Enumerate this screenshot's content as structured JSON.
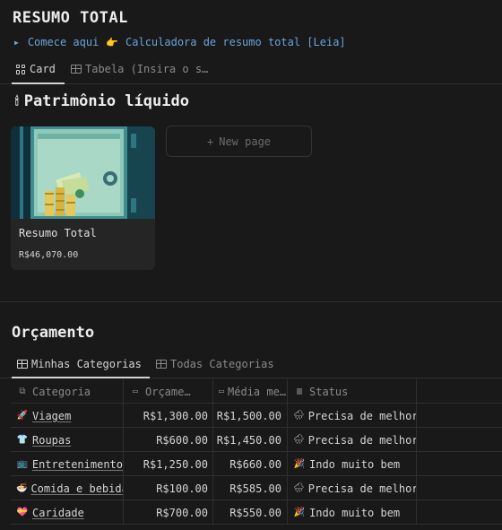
{
  "page": {
    "title": "RESUMO TOTAL"
  },
  "callout": {
    "link1": "Comece aqui",
    "link2": "Calculadora de resumo total [Leia]",
    "pointer_icon": "👉"
  },
  "views": [
    {
      "label": "Card",
      "icon": "gallery-icon"
    },
    {
      "label": "Tabela (Insira o s…",
      "icon": "table-icon"
    }
  ],
  "networth": {
    "title": "Patrimônio líquido",
    "icon": "🕯",
    "card": {
      "title": "Resumo Total",
      "value": "R$46,070.00"
    },
    "new_page_label": "New page",
    "new_page_icon": "+"
  },
  "budget": {
    "title": "Orçamento",
    "tabs": [
      {
        "label": "Minhas Categorias",
        "icon": "table-icon"
      },
      {
        "label": "Todas Categorias",
        "icon": "table-icon"
      }
    ],
    "columns": [
      "Categoria",
      "Orçame…",
      "Média me…",
      "Status"
    ],
    "rows": [
      {
        "emoji": "🚀",
        "category": "Viagem",
        "budget": "R$1,300.00",
        "average": "R$1,500.00",
        "status_emoji": "🌧",
        "status": "Precisa de melhorar"
      },
      {
        "emoji": "👕",
        "category": "Roupas",
        "budget": "R$600.00",
        "average": "R$1,450.00",
        "status_emoji": "🌧",
        "status": "Precisa de melhorar"
      },
      {
        "emoji": "📺",
        "category": "Entretenimento",
        "budget": "R$1,250.00",
        "average": "R$660.00",
        "status_emoji": "🎉",
        "status": "Indo muito bem"
      },
      {
        "emoji": "🍜",
        "category": "Comida e bebida",
        "budget": "R$100.00",
        "average": "R$585.00",
        "status_emoji": "🌧",
        "status": "Precisa de melhorar"
      },
      {
        "emoji": "💝",
        "category": "Caridade",
        "budget": "R$700.00",
        "average": "R$550.00",
        "status_emoji": "🎉",
        "status": "Indo muito bem"
      }
    ]
  },
  "colors": {
    "background": "#191919",
    "link": "#6aa3d8",
    "card": "#252525",
    "border": "#2f2f2f"
  }
}
